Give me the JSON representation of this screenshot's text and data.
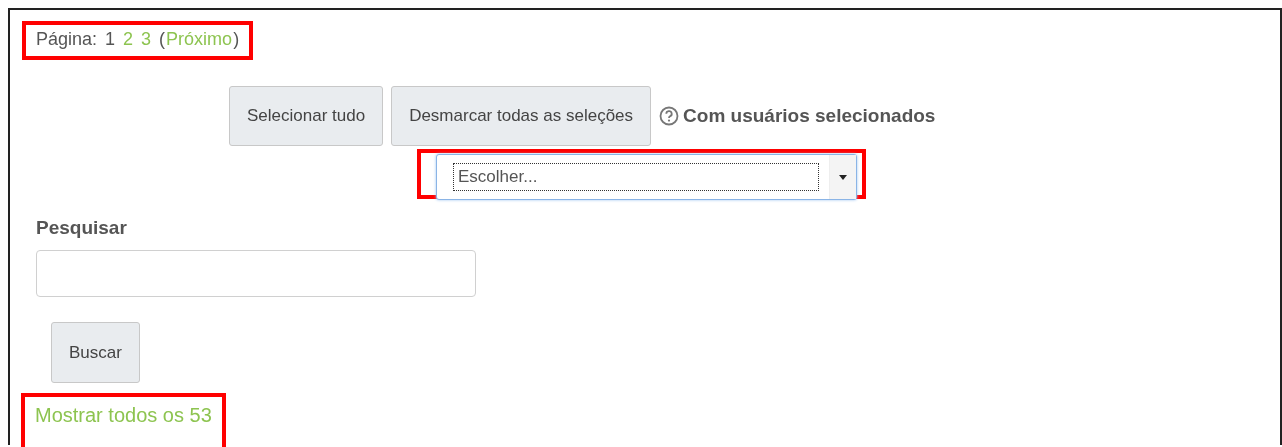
{
  "pagination": {
    "label": "Página:",
    "pages": [
      {
        "label": "1",
        "selected": true
      },
      {
        "label": "2",
        "selected": false
      },
      {
        "label": "3",
        "selected": false
      }
    ],
    "next": {
      "open": "(",
      "label": "Próximo",
      "close": ")"
    },
    "highlighted": true
  },
  "actions": {
    "buttons": [
      "Selecionar tudo",
      "Desmarcar todas as seleções"
    ],
    "with_selected_label": "Com usuários selecionados"
  },
  "bulk_select": {
    "value": "Escolher...",
    "highlighted": true
  },
  "search": {
    "label": "Pesquisar",
    "button": "Buscar"
  },
  "show_all": {
    "label": "Mostrar todos os 53",
    "highlighted": true
  }
}
